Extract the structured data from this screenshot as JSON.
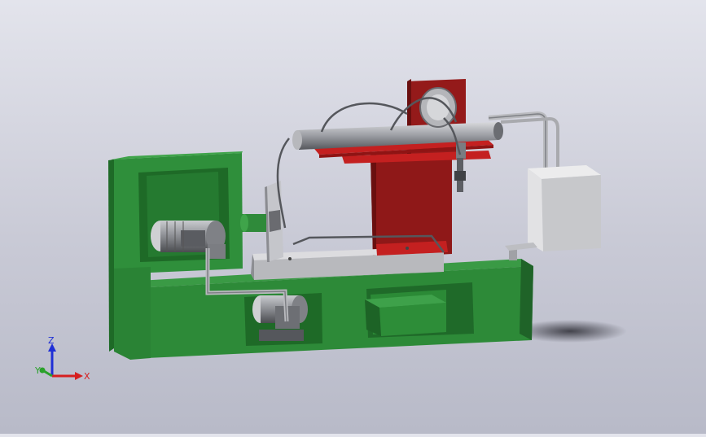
{
  "scene": {
    "description_hidden": "",
    "colors": {
      "background_top": "#e3e4ec",
      "background_bottom": "#b8bac8",
      "base_green": "#2f8a3a",
      "base_green_dark": "#1f6328",
      "column_red": "#8f1818",
      "plate_red": "#c42020",
      "motor_grey": "#8d8f94",
      "tank_grey": "#d4d4d6"
    }
  },
  "triad": {
    "z_label": "Z",
    "y_label": "Y",
    "x_label": "X",
    "z_color": "#1f2fd6",
    "y_color": "#2aa12a",
    "x_color": "#d61f1f"
  }
}
